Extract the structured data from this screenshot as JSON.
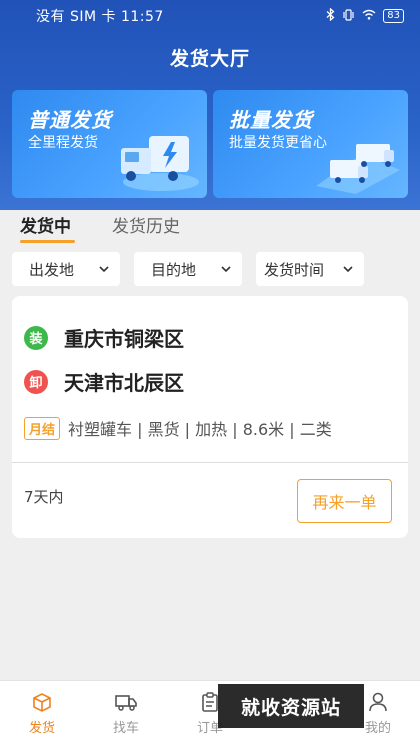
{
  "status": {
    "carrier": "没有 SIM 卡",
    "time": "11:57",
    "battery": "83"
  },
  "header": {
    "title": "发货大厅"
  },
  "banners": [
    {
      "title": "普通发货",
      "subtitle": "全里程发货"
    },
    {
      "title": "批量发货",
      "subtitle": "批量发货更省心"
    }
  ],
  "tabs": {
    "active": "发货中",
    "inactive": "发货历史"
  },
  "filters": [
    "出发地",
    "目的地",
    "发货时间"
  ],
  "order": {
    "load_badge": "装",
    "load_city": "重庆市铜梁区",
    "unload_badge": "卸",
    "unload_city": "天津市北辰区",
    "payment_tag": "月结",
    "details": "衬塑罐车 | 黑货 | 加热 | 8.6米 | 二类",
    "time_range": "7天内",
    "reorder_label": "再来一单"
  },
  "nav": [
    "发货",
    "找车",
    "订单",
    "我的"
  ],
  "watermark": "就收资源站",
  "colors": {
    "brand_blue": "#2152b8",
    "accent_orange": "#f5a028",
    "load_green": "#3cb94a",
    "unload_red": "#ef5350"
  }
}
